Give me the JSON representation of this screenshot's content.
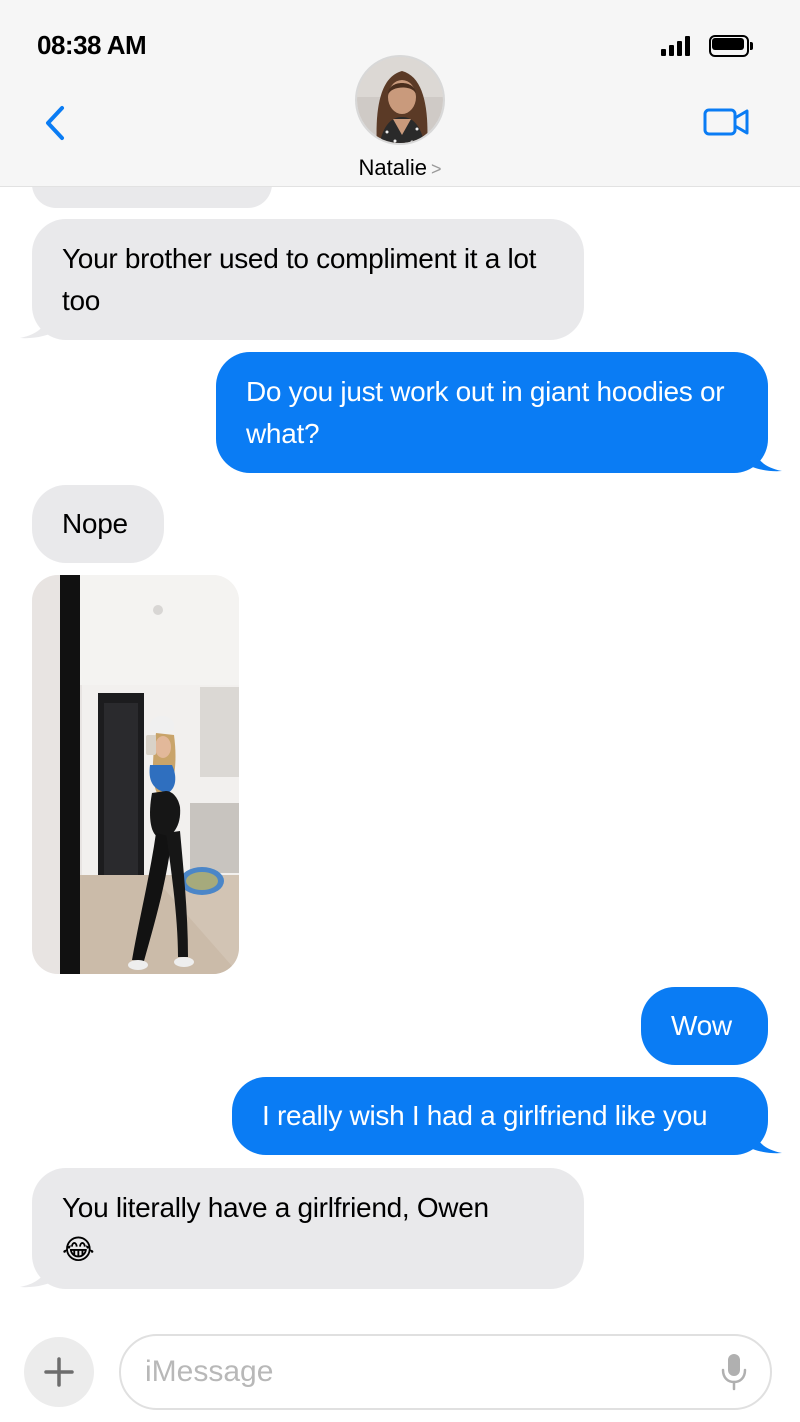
{
  "status_bar": {
    "time": "08:38 AM",
    "signal_icon": "cellular-signal-icon",
    "battery_icon": "battery-icon"
  },
  "header": {
    "back_icon": "chevron-left-icon",
    "contact_name": "Natalie",
    "name_chevron": ">",
    "video_icon": "video-camera-icon",
    "accent_color": "#0a7cf4"
  },
  "messages": [
    {
      "from": "contact",
      "text": "Your brother used to compliment it a lot too"
    },
    {
      "from": "me",
      "text": "Do you just work out in giant hoodies or what?"
    },
    {
      "from": "contact",
      "text": "Nope"
    },
    {
      "from": "contact",
      "type": "photo"
    },
    {
      "from": "me",
      "text": "Wow"
    },
    {
      "from": "me",
      "text": "I really wish I had a girlfriend like you"
    },
    {
      "from": "contact",
      "text": "You literally have a girlfriend, Owen",
      "emoji": "😂"
    }
  ],
  "composer": {
    "plus_icon": "plus-icon",
    "placeholder": "iMessage",
    "mic_icon": "microphone-icon"
  },
  "colors": {
    "outgoing_bubble": "#0a7cf4",
    "incoming_bubble": "#e9e9eb",
    "header_bg": "#f6f6f6"
  }
}
